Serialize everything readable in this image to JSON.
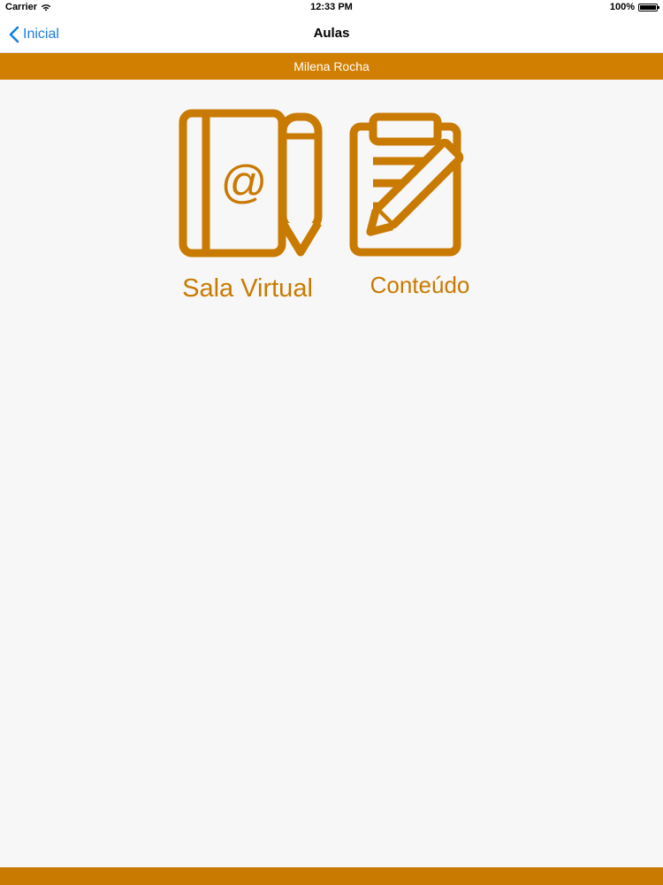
{
  "status_bar": {
    "carrier": "Carrier",
    "time": "12:33 PM",
    "battery": "100%"
  },
  "nav": {
    "back_label": "Inicial",
    "title": "Aulas"
  },
  "user_bar": {
    "name": "Milena Rocha"
  },
  "tiles": [
    {
      "label": "Sala Virtual",
      "icon": "address-book-pencil-icon"
    },
    {
      "label": "Conteúdo",
      "icon": "clipboard-pencil-icon"
    }
  ],
  "colors": {
    "accent": "#d17f00",
    "icon": "#c97a00",
    "link": "#1a7de0",
    "background": "#f7f7f7"
  }
}
